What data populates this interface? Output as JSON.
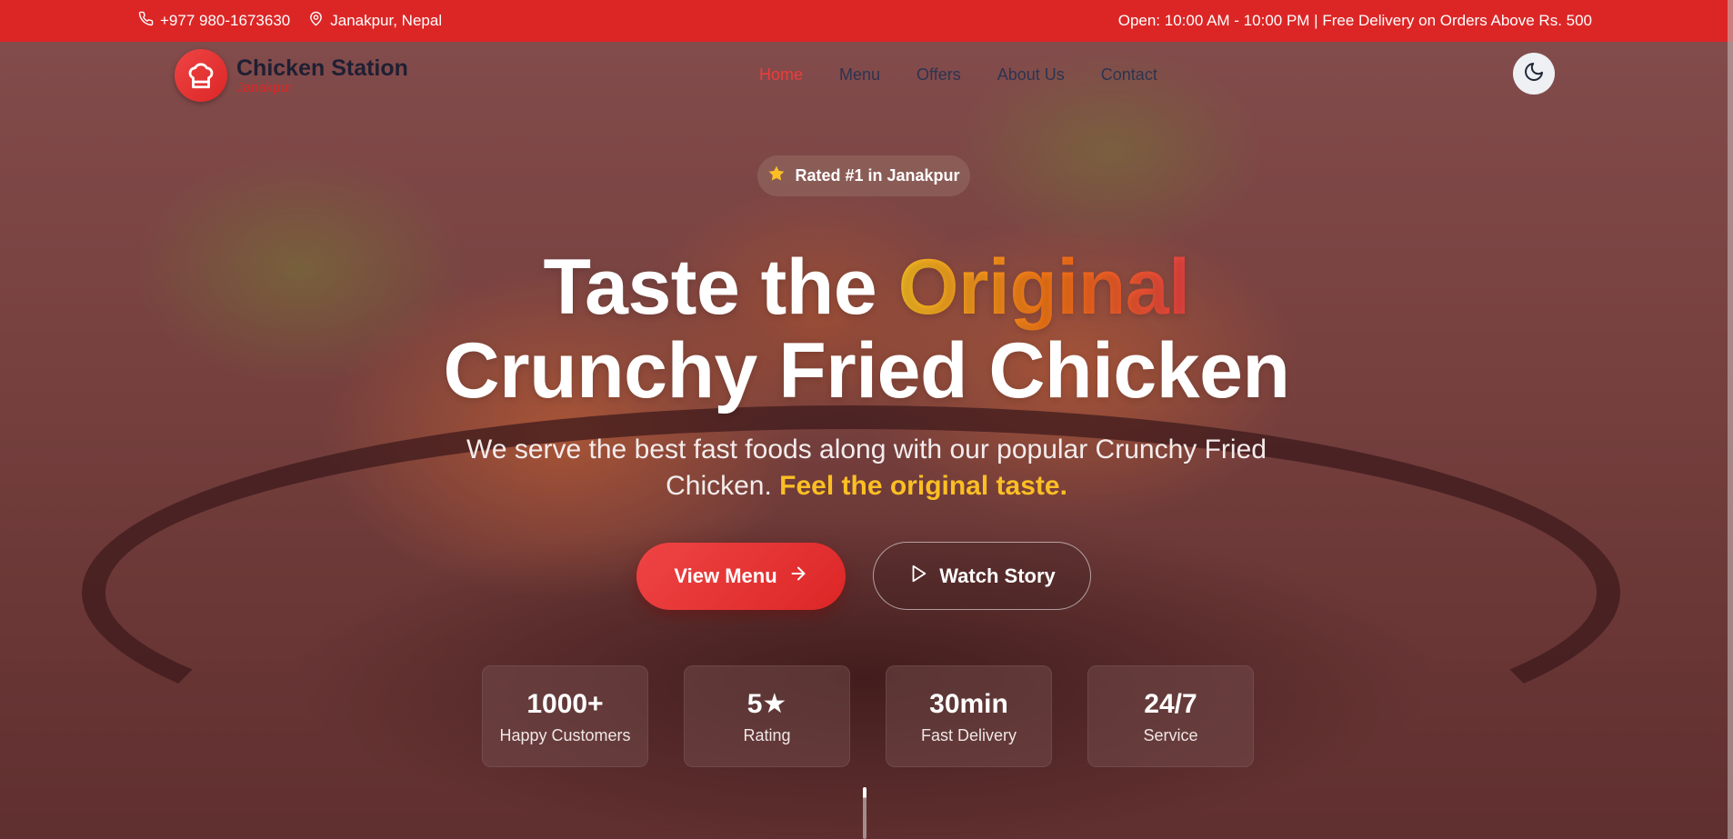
{
  "topbar": {
    "phone": "+977 980-1673630",
    "location": "Janakpur, Nepal",
    "hours_note": "Open: 10:00 AM - 10:00 PM | Free Delivery on Orders Above Rs. 500",
    "phone_icon": "phone-icon",
    "location_icon": "map-pin-icon"
  },
  "brand": {
    "name": "Chicken Station",
    "city": "Janakpur",
    "logo_icon": "chef-hat-icon"
  },
  "nav": {
    "items": [
      {
        "label": "Home",
        "active": true
      },
      {
        "label": "Menu",
        "active": false
      },
      {
        "label": "Offers",
        "active": false
      },
      {
        "label": "About Us",
        "active": false
      },
      {
        "label": "Contact",
        "active": false
      }
    ],
    "theme_toggle_icon": "moon-icon"
  },
  "hero": {
    "badge": "Rated #1 in Janakpur",
    "badge_icon": "star-icon",
    "headline_prefix": "Taste the ",
    "headline_highlight": "Original",
    "headline_line2": "Crunchy Fried Chicken",
    "subtitle": "We serve the best fast foods along with our popular Crunchy Fried Chicken.",
    "subtitle_accent": "Feel the original taste.",
    "primary_button": "View Menu",
    "primary_button_icon": "arrow-right-icon",
    "secondary_button": "Watch Story",
    "secondary_button_icon": "play-icon"
  },
  "stats": [
    {
      "value": "1000+",
      "label": "Happy Customers"
    },
    {
      "value": "5★",
      "label": "Rating"
    },
    {
      "value": "30min",
      "label": "Fast Delivery"
    },
    {
      "value": "24/7",
      "label": "Service"
    }
  ],
  "colors": {
    "brand_red": "#dc2626",
    "accent_yellow": "#fbbf24",
    "accent_orange": "#f97316"
  }
}
